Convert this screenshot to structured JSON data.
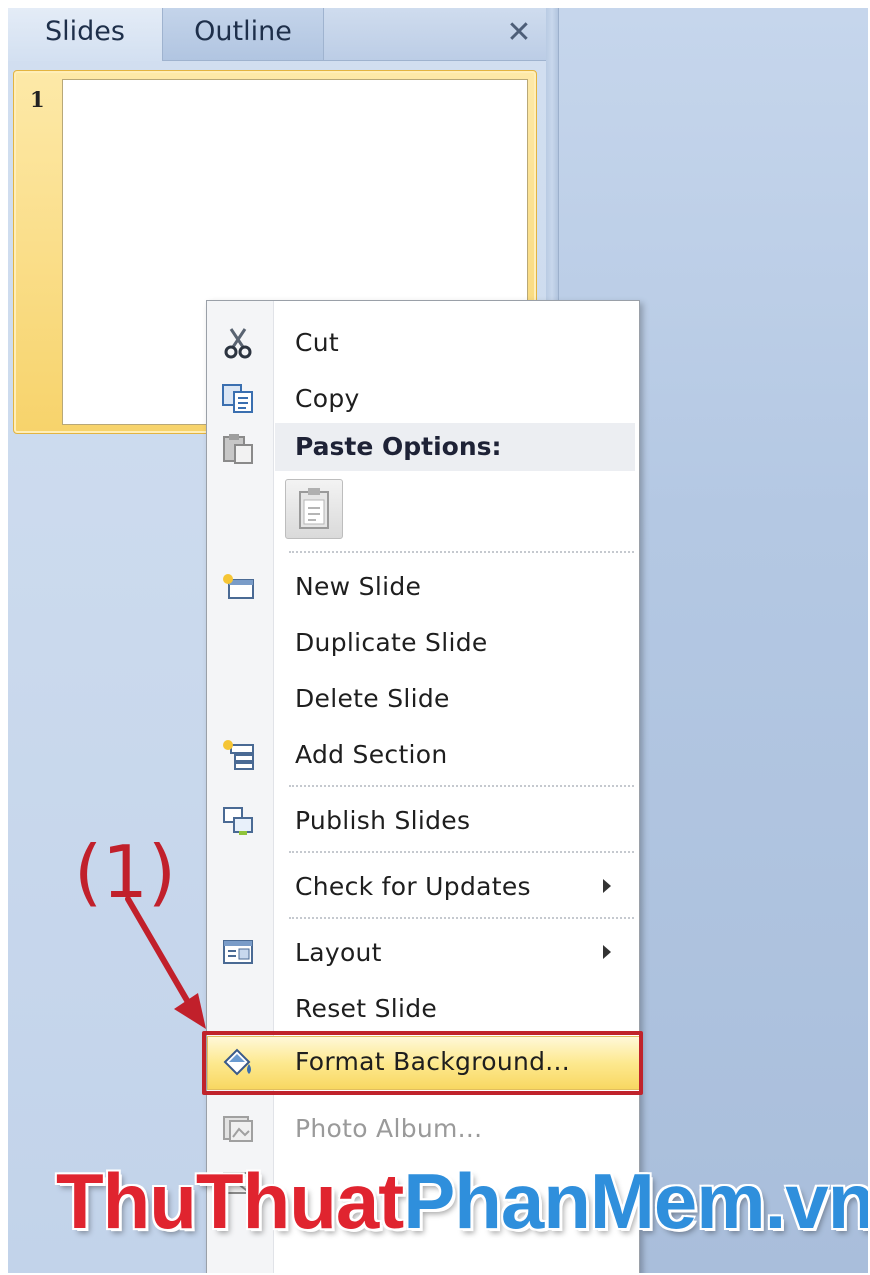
{
  "panel": {
    "tabs": [
      {
        "label": "Slides",
        "active": true
      },
      {
        "label": "Outline",
        "active": false
      }
    ],
    "close_glyph": "✕",
    "slide_number": "1"
  },
  "context_menu": {
    "items": [
      {
        "label": "Cut",
        "icon": "scissors-icon"
      },
      {
        "label": "Copy",
        "icon": "copy-icon"
      },
      {
        "label": "Paste Options:",
        "icon": "paste-icon",
        "header": true
      },
      {
        "label": "New Slide",
        "icon": "new-slide-icon"
      },
      {
        "label": "Duplicate Slide"
      },
      {
        "label": "Delete Slide"
      },
      {
        "label": "Add Section",
        "icon": "add-section-icon"
      },
      {
        "label": "Publish Slides",
        "icon": "publish-slides-icon"
      },
      {
        "label": "Check for Updates",
        "submenu": true
      },
      {
        "label": "Layout",
        "icon": "layout-icon",
        "submenu": true
      },
      {
        "label": "Reset Slide"
      },
      {
        "label": "Format Background...",
        "icon": "format-background-icon",
        "highlighted": true
      },
      {
        "label": "Photo Album...",
        "icon": "photo-album-icon",
        "disabled": true
      }
    ]
  },
  "annotation": {
    "text": "(1)",
    "color": "#c1202b"
  },
  "watermark": {
    "part1": "ThuThuat",
    "part2": "PhanMem.vn",
    "color1": "#e0242f",
    "color2": "#2f8fdc"
  }
}
